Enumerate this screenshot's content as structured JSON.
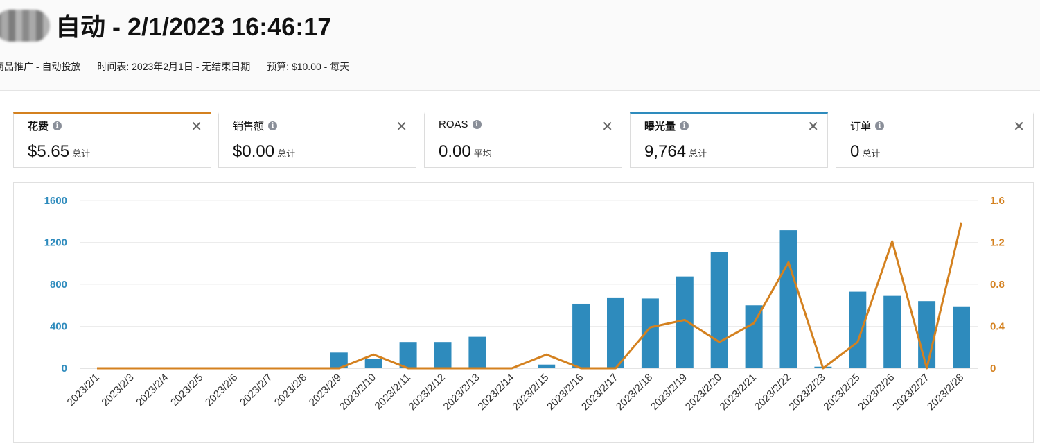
{
  "header": {
    "title": "自动 - 2/1/2023 16:46:17",
    "campaign_type": "商品推广 - 自动投放",
    "schedule": "时间表: 2023年2月1日 - 无结束日期",
    "budget": "预算: $10.00 - 每天"
  },
  "metrics": [
    {
      "label": "花费",
      "value": "$5.65",
      "suffix": "总计",
      "selected": true,
      "accent": "#d4811f"
    },
    {
      "label": "销售额",
      "value": "$0.00",
      "suffix": "总计",
      "selected": false,
      "accent": ""
    },
    {
      "label": "ROAS",
      "value": "0.00",
      "suffix": "平均",
      "selected": false,
      "accent": ""
    },
    {
      "label": "曝光量",
      "value": "9,764",
      "suffix": "总计",
      "selected": true,
      "accent": "#2e8bbd"
    },
    {
      "label": "订单",
      "value": "0",
      "suffix": "总计",
      "selected": false,
      "accent": ""
    }
  ],
  "colors": {
    "bar": "#2e8bbd",
    "line": "#d4811f",
    "left_axis": "#2e8bbd",
    "right_axis": "#d4811f"
  },
  "chart_data": {
    "type": "bar",
    "categories": [
      "2023/2/1",
      "2023/2/3",
      "2023/2/4",
      "2023/2/5",
      "2023/2/6",
      "2023/2/7",
      "2023/2/8",
      "2023/2/9",
      "2023/2/10",
      "2023/2/11",
      "2023/2/12",
      "2023/2/13",
      "2023/2/14",
      "2023/2/15",
      "2023/2/16",
      "2023/2/17",
      "2023/2/18",
      "2023/2/19",
      "2023/2/20",
      "2023/2/21",
      "2023/2/22",
      "2023/2/23",
      "2023/2/25",
      "2023/2/26",
      "2023/2/27",
      "2023/2/28"
    ],
    "series": [
      {
        "type": "bar",
        "axis": "left",
        "values": [
          0,
          0,
          0,
          0,
          0,
          0,
          0,
          150,
          90,
          250,
          250,
          300,
          0,
          35,
          615,
          675,
          665,
          875,
          1110,
          600,
          1315,
          15,
          730,
          690,
          640,
          590
        ]
      },
      {
        "type": "line",
        "axis": "right",
        "values": [
          0,
          0,
          0,
          0,
          0,
          0,
          0,
          0,
          0.13,
          0,
          0,
          0,
          0,
          0.13,
          0,
          0,
          0.39,
          0.46,
          0.25,
          0.43,
          1.01,
          0,
          0.25,
          1.21,
          0,
          1.39
        ]
      }
    ],
    "ylim_left": [
      0,
      1600
    ],
    "yticks_left": [
      0,
      400,
      800,
      1200,
      1600
    ],
    "ylim_right": [
      0,
      1.6
    ],
    "yticks_right": [
      "0",
      "0.4",
      "0.8",
      "1.2",
      "1.6"
    ],
    "grid": true
  }
}
